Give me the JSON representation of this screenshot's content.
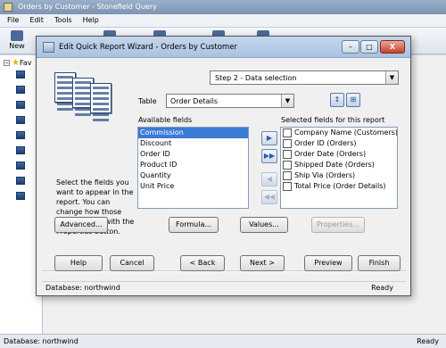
{
  "app": {
    "title": "Orders by Customer - Stonefield Query",
    "menu": [
      "File",
      "Edit",
      "Tools",
      "Help"
    ],
    "toolbar_new_label": "New",
    "tree_root_label": "Fav",
    "status_text": "Database: northwind",
    "status_ready": "Ready"
  },
  "dialog": {
    "title": "Edit Quick Report Wizard - Orders by Customer",
    "window_buttons": {
      "minimize": "–",
      "maximize": "□",
      "close": "X"
    },
    "step": "Step 2 - Data selection",
    "table_label": "Table",
    "table_value": "Order Details",
    "available_label": "Available fields",
    "selected_label": "Selected fields for this report",
    "help_text": "Select the fields you want to appear in the report. You can change how those fields appear with the Properties button.",
    "available_fields": [
      "Commission",
      "Discount",
      "Order ID",
      "Product ID",
      "Quantity",
      "Unit Price"
    ],
    "selected_index": 0,
    "selected_fields": [
      "Company Name (Customers)",
      "Order ID (Orders)",
      "Order Date (Orders)",
      "Shipped Date (Orders)",
      "Ship Via (Orders)",
      "Total Price (Order Details)"
    ],
    "move_buttons": {
      "add": "▶",
      "add_all": "▶▶",
      "remove": "◀",
      "remove_all": "◀◀"
    },
    "mid_buttons": {
      "advanced": "Advanced...",
      "formula": "Formula...",
      "values": "Values...",
      "properties": "Properties..."
    },
    "nav_buttons": {
      "help": "Help",
      "cancel": "Cancel",
      "back": "< Back",
      "next": "Next >",
      "preview": "Preview",
      "finish": "Finish"
    },
    "status_text": "Database: northwind",
    "status_ready": "Ready"
  },
  "icons": {
    "sort": "sort-az-icon",
    "tree": "tree-view-icon",
    "combo_arrow": "▼"
  }
}
